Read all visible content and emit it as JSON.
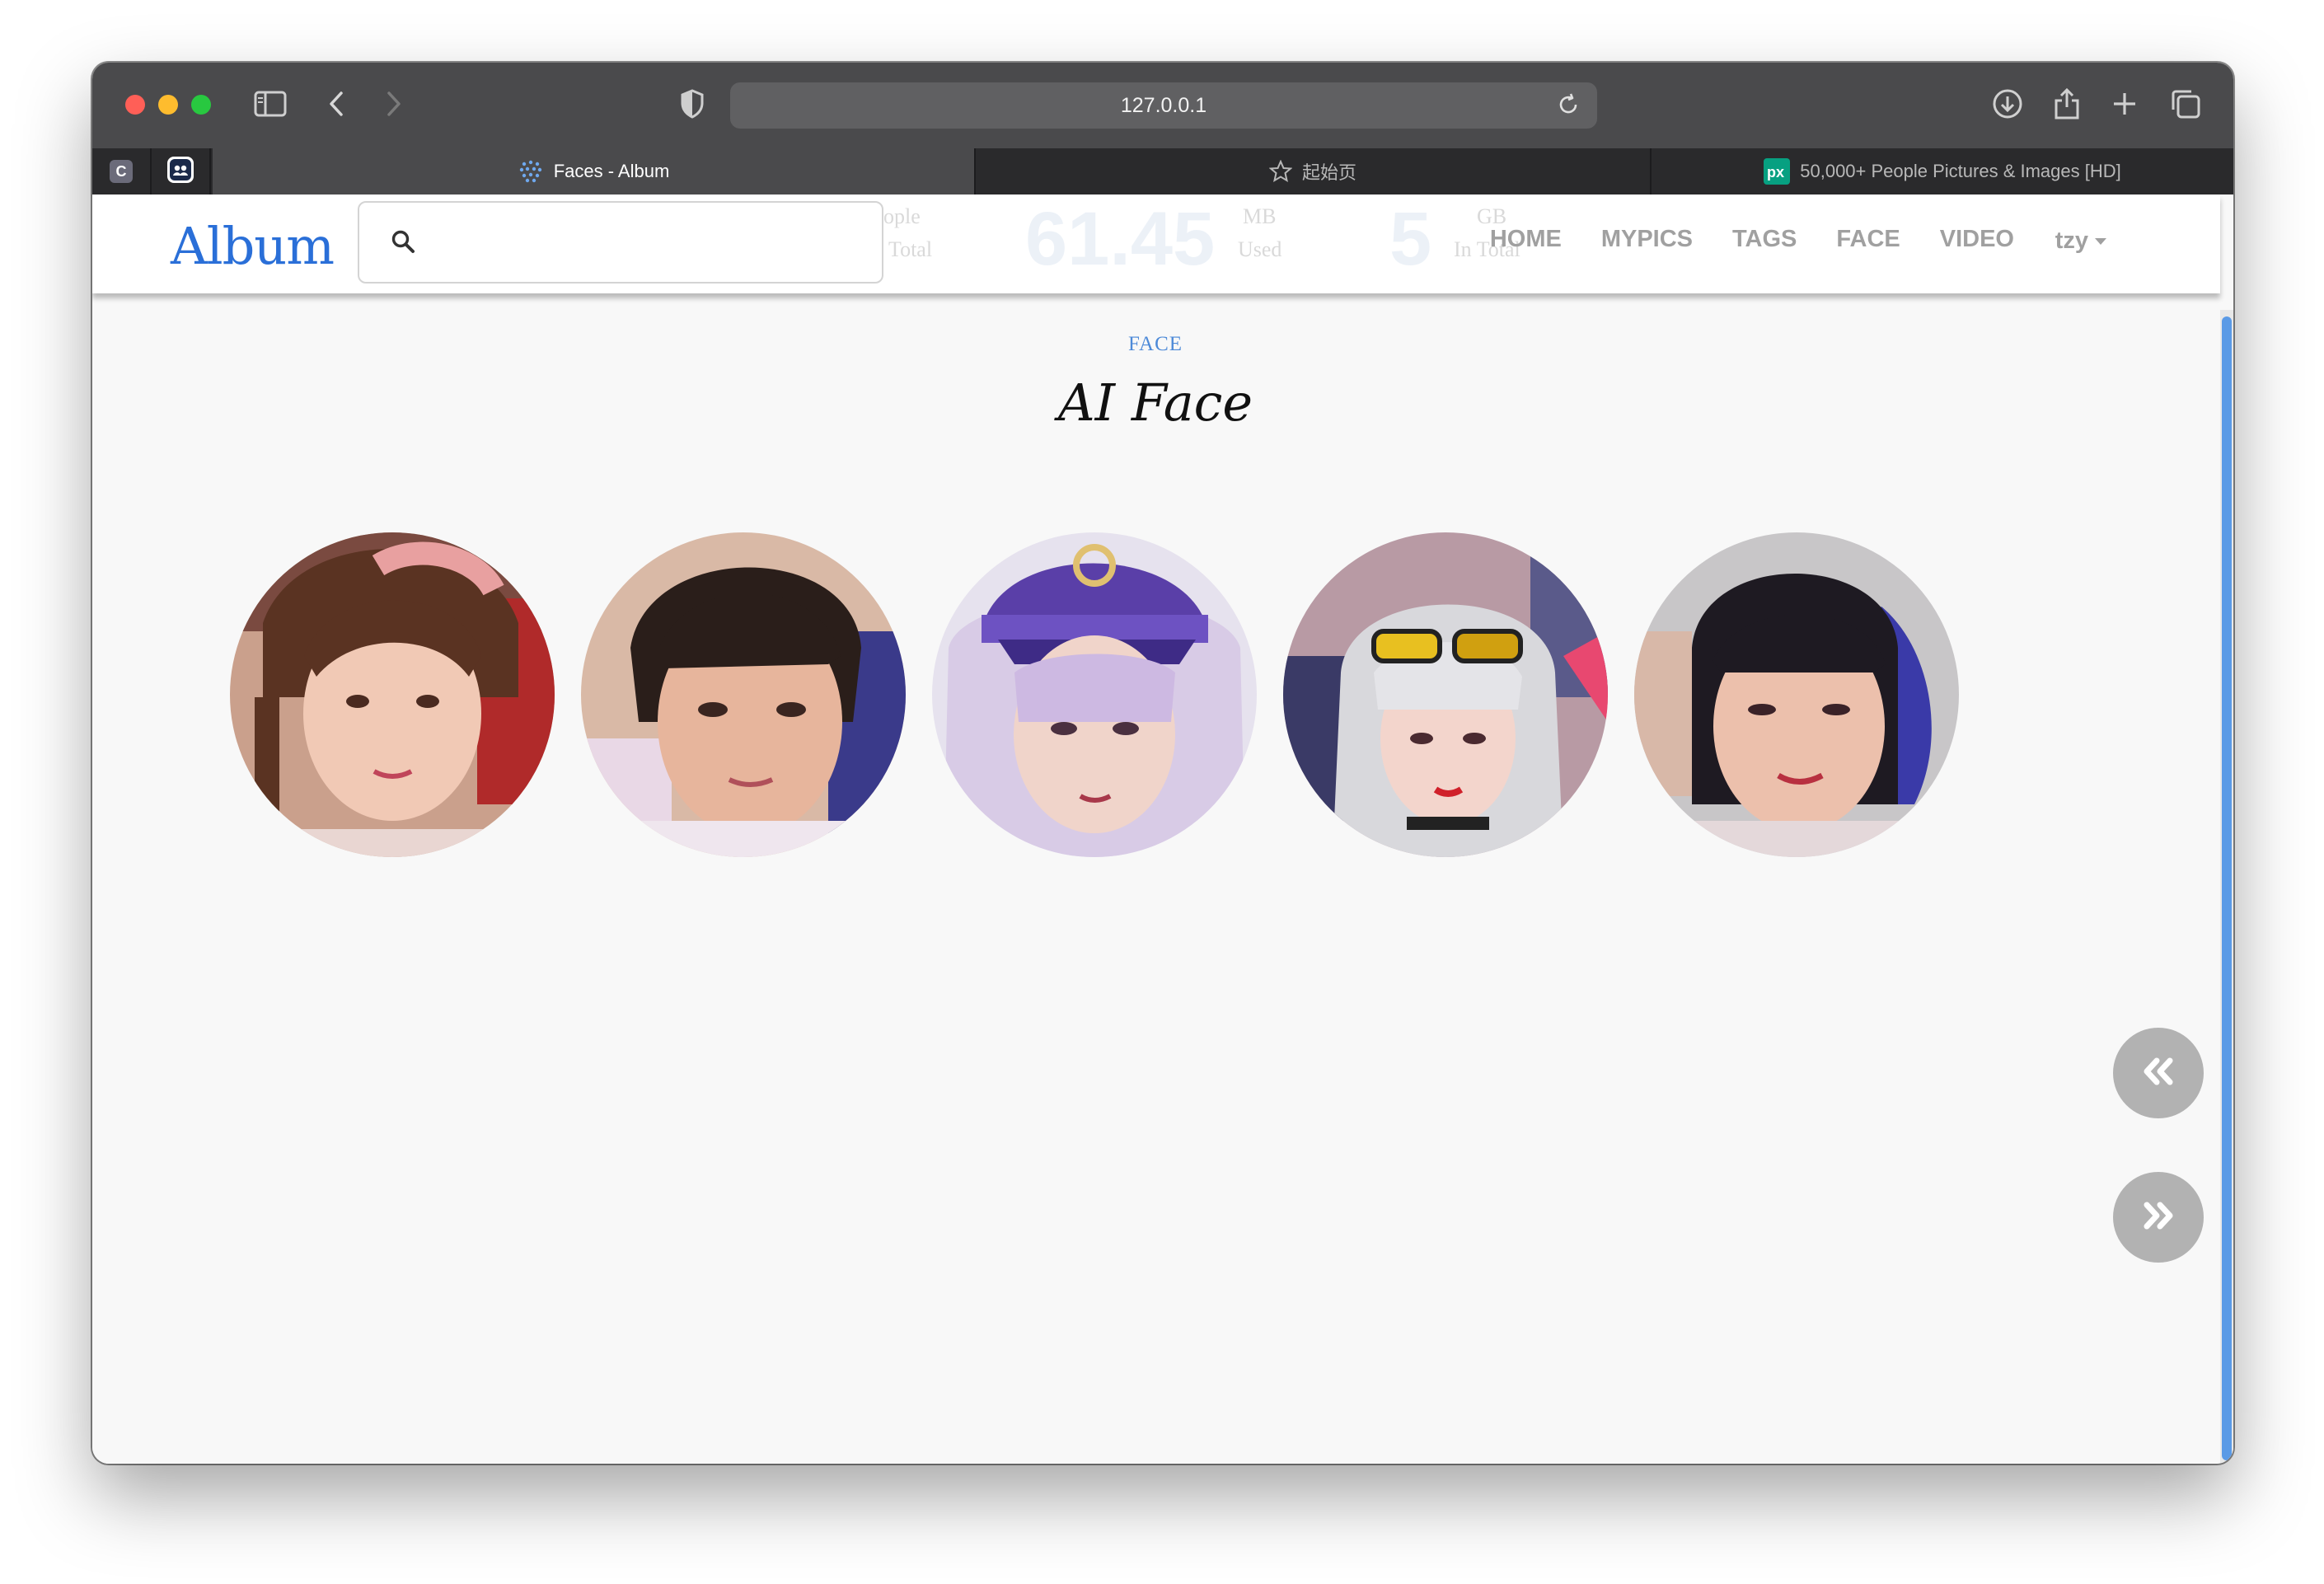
{
  "browser": {
    "url": "127.0.0.1",
    "tabs": [
      {
        "title": "Faces - Album",
        "active": true
      },
      {
        "title": "起始页",
        "active": false
      },
      {
        "title": "50,000+ People Pictures & Images [HD]",
        "active": false
      }
    ],
    "pinned_tabs": [
      "C",
      "people-app"
    ]
  },
  "navbar": {
    "brand": "Album",
    "search": {
      "value": "",
      "placeholder": ""
    },
    "menu": [
      "HOME",
      "MYPICS",
      "TAGS",
      "FACE",
      "VIDEO"
    ],
    "user": "tzy"
  },
  "background_stats": {
    "people_label": [
      "ople",
      "Total"
    ],
    "mb_value": "61.45",
    "mb_label": [
      "MB",
      "Used"
    ],
    "gb_value": "5",
    "gb_label": [
      "GB",
      "In Total"
    ]
  },
  "page": {
    "section_label": "FACE",
    "title": "AI Face",
    "faces_count_shown": 5
  },
  "pager": {
    "prev_icon": "double-chevron-left-icon",
    "next_icon": "double-chevron-right-icon"
  },
  "colors": {
    "brand": "#2a6fd8",
    "accent": "#4d8ad8",
    "scrollbar": "#5a9ae6",
    "fab": "#b2b2b2"
  }
}
